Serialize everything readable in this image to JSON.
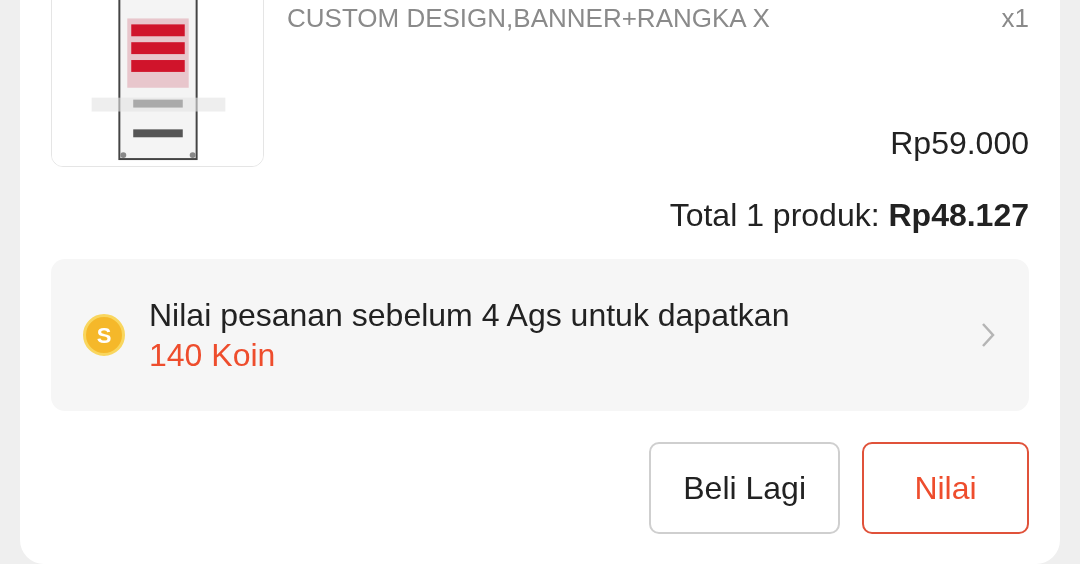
{
  "product": {
    "name": "CUSTOM DESIGN,BANNER+RANGKA X",
    "quantity": "x1",
    "price": "Rp59.000"
  },
  "total": {
    "label": "Total 1 produk: ",
    "amount": "Rp48.127"
  },
  "coin_offer": {
    "text": "Nilai pesanan sebelum 4 Ags untuk dapatkan",
    "reward": "140 Koin",
    "coin_symbol": "S"
  },
  "buttons": [
    {
      "label": "Beli Lagi",
      "kind": "secondary"
    },
    {
      "label": "Nilai",
      "kind": "primary"
    }
  ]
}
